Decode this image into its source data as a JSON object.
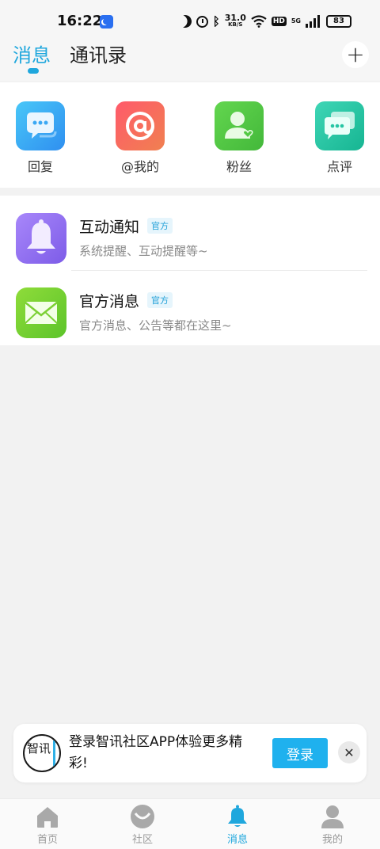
{
  "status_bar": {
    "time": "16:22",
    "speed_value": "31.0",
    "speed_unit": "KB/S",
    "hd": "HD",
    "network": "5G",
    "battery": "83"
  },
  "header": {
    "tabs": [
      {
        "label": "消息",
        "active": true
      },
      {
        "label": "通讯录",
        "active": false
      }
    ],
    "add_icon": "plus-icon"
  },
  "shortcuts": [
    {
      "label": "回复",
      "icon": "chat-bubble-icon",
      "color": "#3aa8f4"
    },
    {
      "label": "@我的",
      "icon": "at-sign-icon",
      "color": "#f45d65"
    },
    {
      "label": "粉丝",
      "icon": "fan-user-icon",
      "color": "#54c944"
    },
    {
      "label": "点评",
      "icon": "comment-icon",
      "color": "#26c5a4"
    }
  ],
  "messages": [
    {
      "title": "互动通知",
      "badge": "官方",
      "subtitle": "系统提醒、互动提醒等~",
      "icon": "bell-icon"
    },
    {
      "title": "官方消息",
      "badge": "官方",
      "subtitle": "官方消息、公告等都在这里~",
      "icon": "envelope-icon"
    }
  ],
  "login_banner": {
    "logo_text": "智讯",
    "text": "登录智讯社区APP体验更多精彩!",
    "button": "登录",
    "close_icon": "close-icon"
  },
  "bottom_nav": [
    {
      "label": "首页",
      "icon": "home-icon",
      "active": false
    },
    {
      "label": "社区",
      "icon": "community-icon",
      "active": false
    },
    {
      "label": "消息",
      "icon": "bell-icon",
      "active": true
    },
    {
      "label": "我的",
      "icon": "user-icon",
      "active": false
    }
  ],
  "colors": {
    "accent": "#1fa7dd",
    "background": "#f2f2f2",
    "inactive_nav": "#9a9a9a"
  }
}
